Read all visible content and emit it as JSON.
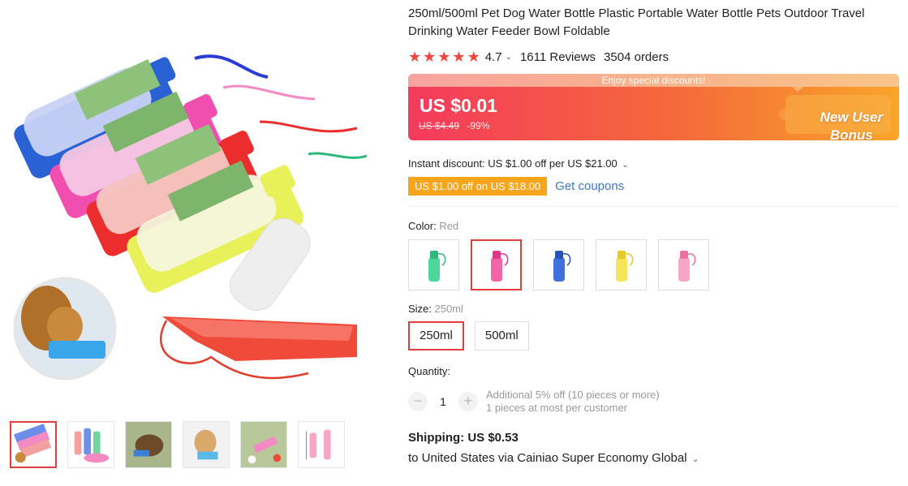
{
  "product": {
    "title": "250ml/500ml Pet Dog Water Bottle Plastic Portable Water Bottle Pets Outdoor Travel Drinking Water Feeder Bowl Foldable",
    "rating": "4.7",
    "reviews": "1611 Reviews",
    "orders": "3504 orders",
    "star_color": "#f0463c"
  },
  "promo": {
    "banner": "Enjoy special discounts!",
    "price": "US $0.01",
    "old_price": "US $4.49",
    "discount": "-99%",
    "bonus_line1": "New User",
    "bonus_line2": "Bonus"
  },
  "coupons": {
    "instant_discount": "Instant discount: US $1.00 off per US $21.00",
    "tag": "US $1.00 off on US $18.00",
    "get_coupons": "Get coupons"
  },
  "color": {
    "label": "Color:",
    "selected": "Red",
    "options": [
      {
        "color": "#4fd69a",
        "cap": "#2fb87a"
      },
      {
        "color": "#f564a8",
        "cap": "#e2348a"
      },
      {
        "color": "#3f6fd8",
        "cap": "#2a52b8"
      },
      {
        "color": "#f6e45a",
        "cap": "#e6c829"
      },
      {
        "color": "#f7a7c6",
        "cap": "#ef6fa0"
      }
    ]
  },
  "size": {
    "label": "Size:",
    "selected": "250ml",
    "options": [
      "250ml",
      "500ml"
    ]
  },
  "quantity": {
    "label": "Quantity:",
    "value": "1",
    "minus": "−",
    "plus": "+",
    "note_line1": "Additional 5% off (10 pieces or more)",
    "note_line2": "1 pieces at most per customer"
  },
  "shipping": {
    "label": "Shipping: US $0.53",
    "to": "to United States via Cainiao Super Economy Global"
  }
}
